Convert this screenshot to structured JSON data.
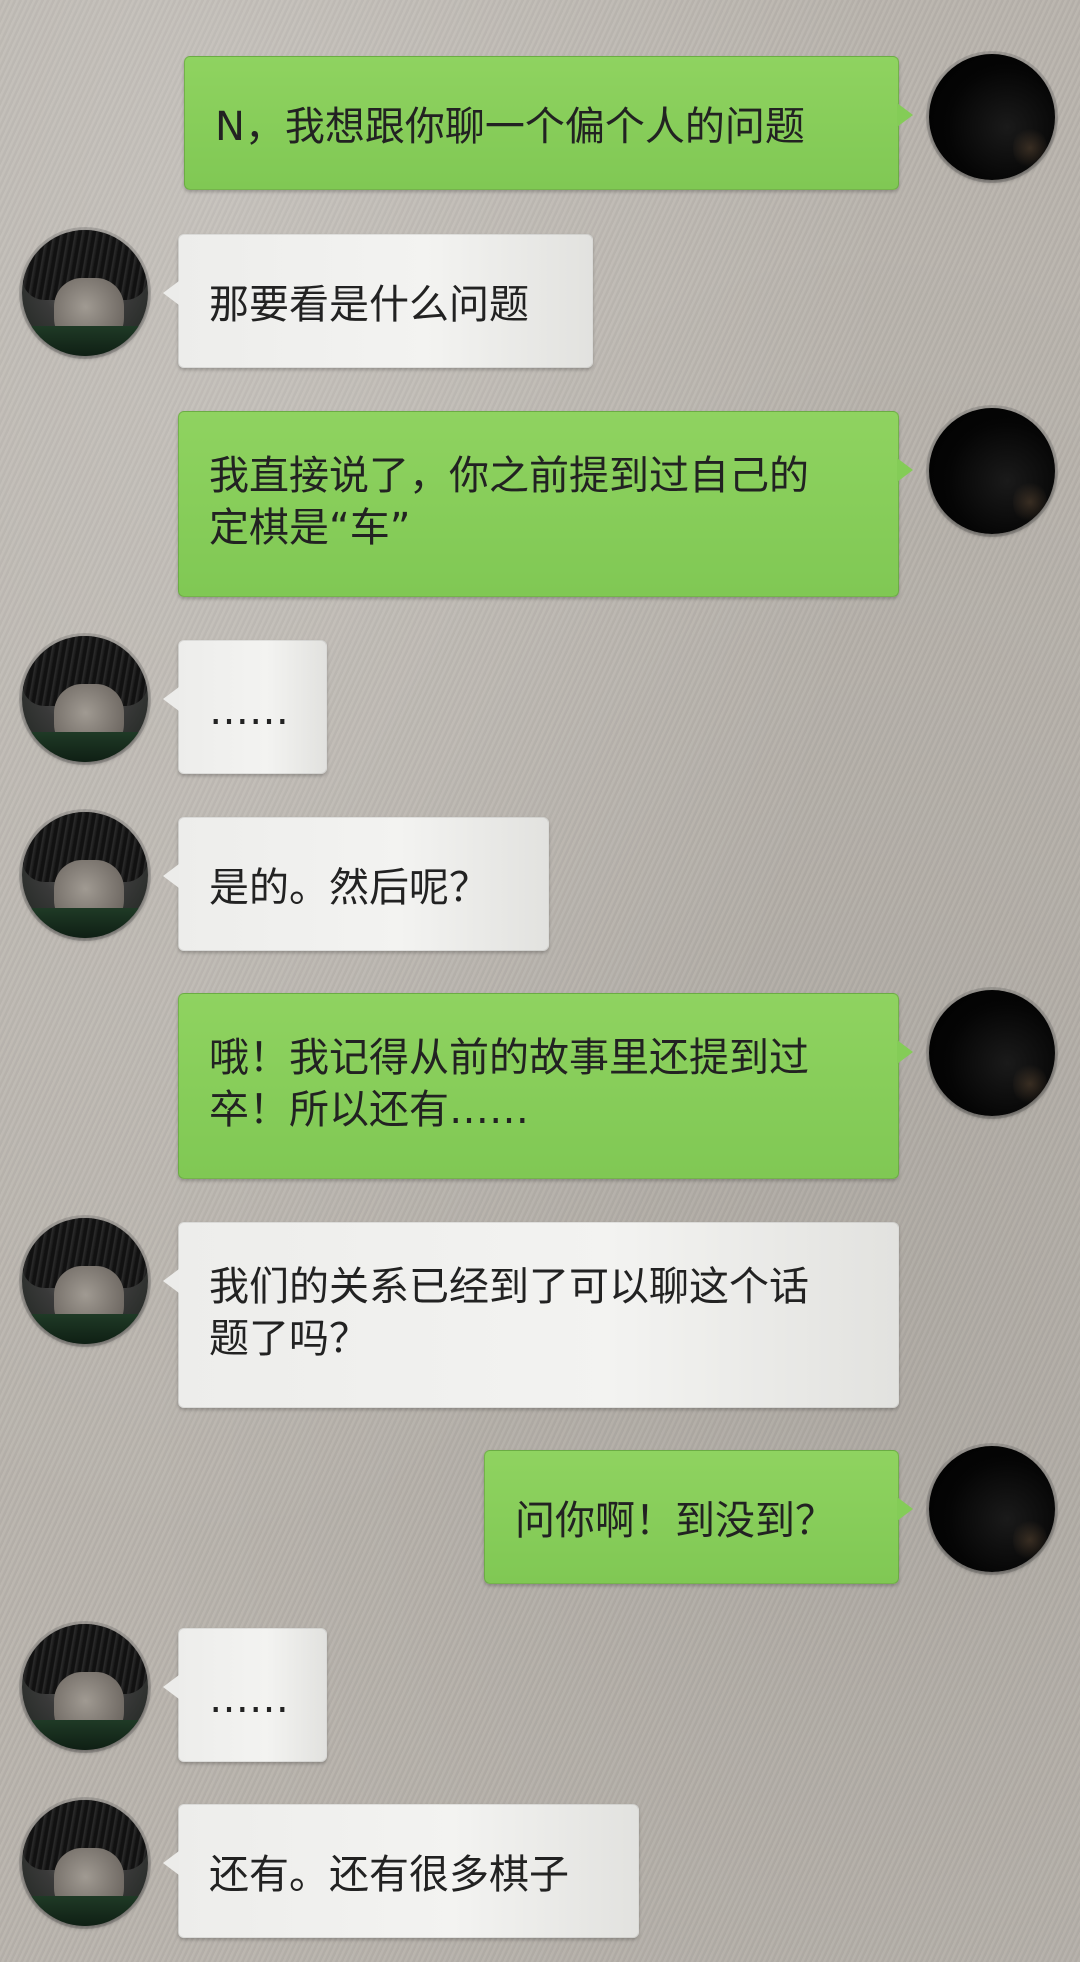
{
  "chat": {
    "messages": [
      {
        "sender": "self",
        "text": "N，我想跟你聊一个偏个人的问题"
      },
      {
        "sender": "other",
        "text": "那要看是什么问题"
      },
      {
        "sender": "self",
        "text": "我直接说了，你之前提到过自己的\n定棋是“车”"
      },
      {
        "sender": "other",
        "text": "……"
      },
      {
        "sender": "other",
        "text": "是的。然后呢？"
      },
      {
        "sender": "self",
        "text": "哦！我记得从前的故事里还提到过\n卒！所以还有……"
      },
      {
        "sender": "other",
        "text": "我们的关系已经到了可以聊这个话\n题了吗？"
      },
      {
        "sender": "self",
        "text": "问你啊！到没到？"
      },
      {
        "sender": "other",
        "text": "……"
      },
      {
        "sender": "other",
        "text": "还有。还有很多棋子"
      }
    ]
  },
  "colors": {
    "self_bubble": "#86cd58",
    "other_bubble": "#efefed",
    "background": "#b9b4ad"
  }
}
